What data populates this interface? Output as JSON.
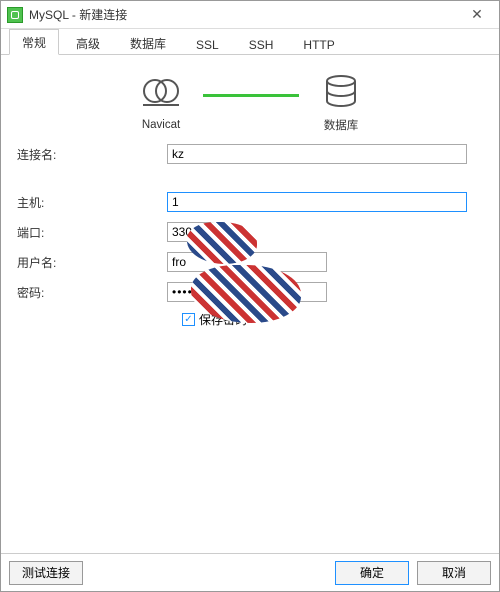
{
  "window": {
    "title": "MySQL - 新建连接",
    "close_glyph": "✕"
  },
  "tabs": [
    "常规",
    "高级",
    "数据库",
    "SSL",
    "SSH",
    "HTTP"
  ],
  "diagram": {
    "left_label": "Navicat",
    "right_label": "数据库"
  },
  "form": {
    "connection_name": {
      "label": "连接名:",
      "value": "kz"
    },
    "host": {
      "label": "主机:",
      "value": "1"
    },
    "port": {
      "label": "端口:",
      "value": "3306"
    },
    "username": {
      "label": "用户名:",
      "value": "fro"
    },
    "password": {
      "label": "密码:",
      "value": "••••••"
    },
    "save_password": {
      "label": "保存密码",
      "checked": true
    }
  },
  "footer": {
    "test": "测试连接",
    "ok": "确定",
    "cancel": "取消"
  }
}
